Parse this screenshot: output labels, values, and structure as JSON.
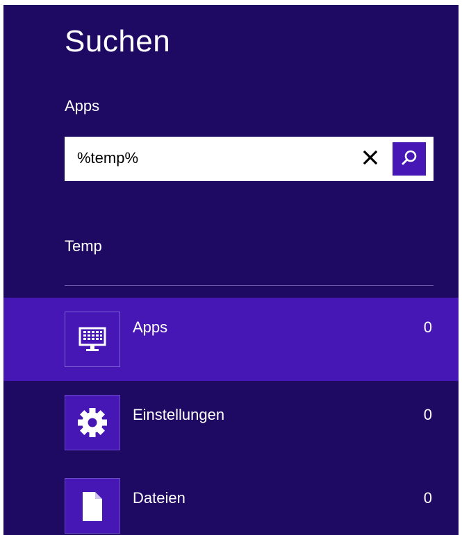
{
  "pane": {
    "title": "Suchen",
    "scope": "Apps"
  },
  "search": {
    "value": "%temp%",
    "placeholder": "",
    "clear_icon": "close-icon",
    "search_icon": "magnifier-icon"
  },
  "results": {
    "heading": "Temp",
    "categories": [
      {
        "label": "Apps",
        "count": "0",
        "icon": "apps-monitor-icon",
        "selected": true
      },
      {
        "label": "Einstellungen",
        "count": "0",
        "icon": "gear-icon",
        "selected": false
      },
      {
        "label": "Dateien",
        "count": "0",
        "icon": "file-icon",
        "selected": false
      }
    ]
  },
  "colors": {
    "pane_background": "#1f0a63",
    "accent": "#4617b4",
    "text": "#ffffff"
  }
}
